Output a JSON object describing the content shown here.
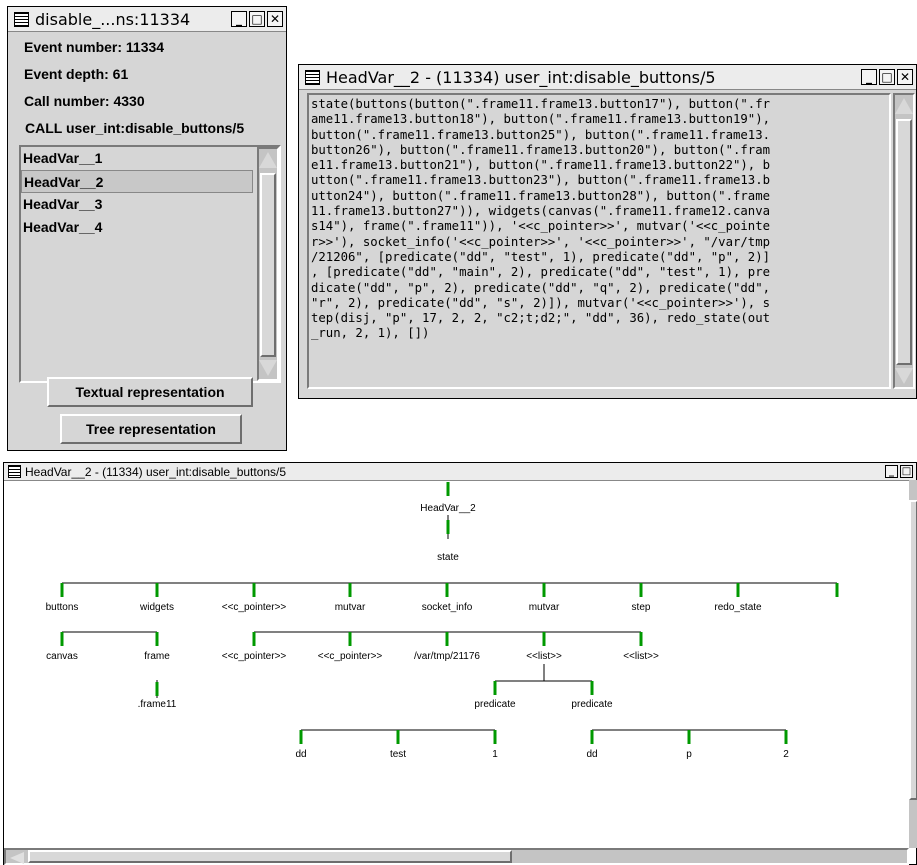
{
  "trace_window": {
    "title": "disable_...ns:11334",
    "event_number": "Event number: 11334",
    "event_depth": "Event depth: 61",
    "call_number": "Call number: 4330",
    "call_label": "CALL user_int:disable_buttons/5",
    "head_vars": [
      "HeadVar__1",
      "HeadVar__2",
      "HeadVar__3",
      "HeadVar__4"
    ],
    "selected_index": 1,
    "textual_button": "Textual representation",
    "tree_button": "Tree representation"
  },
  "text_window": {
    "title": "HeadVar__2 - (11334) user_int:disable_buttons/5",
    "lines": [
      "state(buttons(button(\".frame11.frame13.button17\"), button(\".fr",
      "ame11.frame13.button18\"), button(\".frame11.frame13.button19\"),",
      "button(\".frame11.frame13.button25\"), button(\".frame11.frame13.",
      "button26\"), button(\".frame11.frame13.button20\"), button(\".fram",
      "e11.frame13.button21\"), button(\".frame11.frame13.button22\"), b",
      "utton(\".frame11.frame13.button23\"), button(\".frame11.frame13.b",
      "utton24\"), button(\".frame11.frame13.button28\"), button(\".frame",
      "11.frame13.button27\")), widgets(canvas(\".frame11.frame12.canva",
      "s14\"), frame(\".frame11\")), '<<c_pointer>>', mutvar('<<c_pointe",
      "r>>'), socket_info('<<c_pointer>>', '<<c_pointer>>', \"/var/tmp",
      "/21206\", [predicate(\"dd\", \"test\", 1), predicate(\"dd\", \"p\", 2)]",
      ", [predicate(\"dd\", \"main\", 2), predicate(\"dd\", \"test\", 1), pre",
      "dicate(\"dd\", \"p\", 2), predicate(\"dd\", \"q\", 2), predicate(\"dd\",",
      "\"r\", 2), predicate(\"dd\", \"s\", 2)]), mutvar('<<c_pointer>>'), s",
      "tep(disj, \"p\", 17, 2, 2, \"c2;t;d2;\", \"dd\", 36), redo_state(out",
      "_run, 2, 1), [])"
    ]
  },
  "tree_window": {
    "title": "HeadVar__2 - (11334) user_int:disable_buttons/5",
    "root": "HeadVar__2",
    "level1": [
      "state"
    ],
    "level2": [
      "buttons",
      "widgets",
      "<<c_pointer>>",
      "mutvar",
      "socket_info",
      "mutvar",
      "step",
      "redo_state"
    ],
    "level3": [
      "canvas",
      "frame",
      "<<c_pointer>>",
      "<<c_pointer>>",
      "/var/tmp/21176",
      "<<list>>",
      "<<list>>"
    ],
    "level4": [
      ".frame11",
      "predicate",
      "predicate"
    ],
    "level5": [
      "dd",
      "test",
      "1",
      "dd",
      "p",
      "2"
    ]
  },
  "icons": {
    "menu": "window-menu-icon",
    "minimize": "minimize-icon",
    "maximize": "maximize-icon",
    "close": "close-icon",
    "scroll_up": "scroll-up-arrow-icon",
    "scroll_down": "scroll-down-arrow-icon",
    "scroll_left": "scroll-left-arrow-icon"
  },
  "colors": {
    "tree_tick": "#009900",
    "window_bg": "#d6d6d6"
  }
}
